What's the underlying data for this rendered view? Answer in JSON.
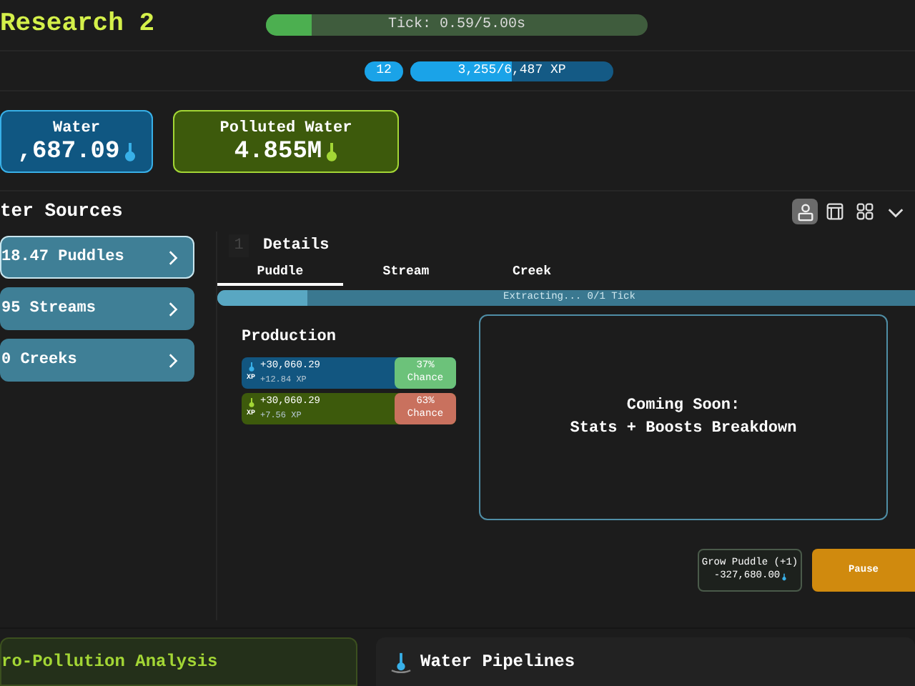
{
  "header": {
    "title": "Research 2",
    "tick": {
      "label": "Tick: 0.59/5.00s",
      "level": 0.118
    }
  },
  "xp": {
    "level_badge": "12",
    "label": "3,255/6,487 XP",
    "level": 0.502
  },
  "resources": [
    {
      "kind": "water",
      "name": "Water",
      "amount": ",687.09"
    },
    {
      "kind": "polluted",
      "name": "Polluted Water",
      "amount": "4.855M"
    }
  ],
  "sources": {
    "title": "ter Sources",
    "view_buttons": [
      {
        "kind": "person",
        "selected": true
      },
      {
        "kind": "panel",
        "selected": false
      },
      {
        "kind": "grid",
        "selected": false
      },
      {
        "kind": "chevron",
        "selected": false
      }
    ],
    "items": [
      {
        "label": "18.47 Puddles",
        "selected": true
      },
      {
        "label": "95 Streams",
        "selected": false
      },
      {
        "label": "0 Creeks",
        "selected": false
      }
    ]
  },
  "details": {
    "index": "1",
    "title": "Details",
    "tabs": [
      {
        "label": "Puddle",
        "selected": true
      },
      {
        "label": "Stream",
        "selected": false
      },
      {
        "label": "Creek",
        "selected": false
      }
    ],
    "extract": {
      "label": "Extracting... 0/1 Tick",
      "level": 0.13
    },
    "production": {
      "title": "Production",
      "rows": [
        {
          "kind": "water",
          "amount": "+30,060.29",
          "xp_tag": "XP",
          "xp": "+12.84 XP",
          "chance": "37%",
          "chance_label": "Chance"
        },
        {
          "kind": "polluted",
          "amount": "+30,060.29",
          "xp_tag": "XP",
          "xp": "+7.56 XP",
          "chance": "63%",
          "chance_label": "Chance"
        }
      ]
    },
    "coming_soon": {
      "title": "Coming Soon:",
      "subtitle": "Stats + Boosts Breakdown"
    },
    "grow_button": {
      "label": "Grow Puddle (+1)",
      "cost": "-327,680.00"
    },
    "pause_button": {
      "label": "Pause"
    }
  },
  "panels": [
    {
      "kind": "pollution",
      "title": "ro-Pollution Analysis"
    },
    {
      "kind": "pipelines",
      "title": "Water Pipelines"
    }
  ]
}
